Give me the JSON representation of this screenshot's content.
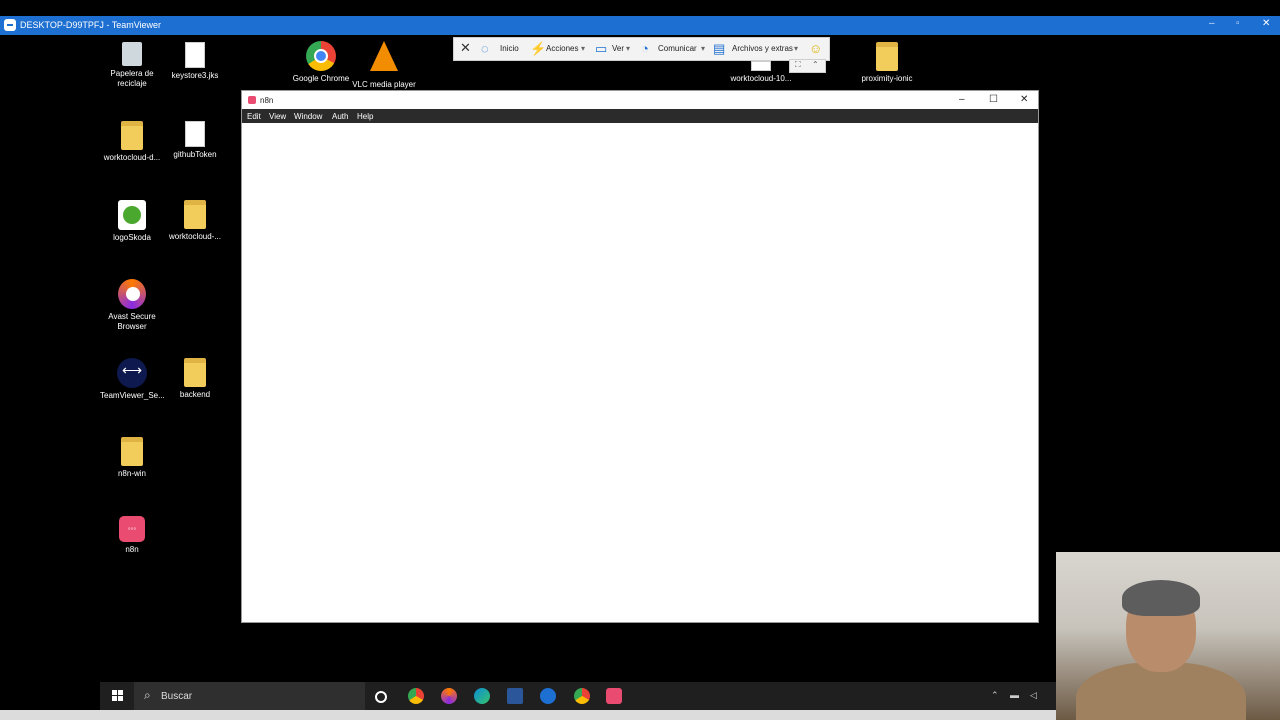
{
  "teamviewer": {
    "title": "DESKTOP-D99TPFJ - TeamViewer",
    "toolbar": {
      "close": "✕",
      "inicio": "Inicio",
      "acciones": "Acciones",
      "ver": "Ver",
      "comunicar": "Comunicar",
      "archivos": "Archivos y extras"
    }
  },
  "desktop_icons": {
    "recycle": "Papelera de reciclaje",
    "keystore": "keystore3.jks",
    "chrome": "Google Chrome",
    "vlc": "VLC media player",
    "worktocloud10": "worktocloud-10...",
    "proximity": "proximity-ionic",
    "worktocloud_d": "worktocloud-d...",
    "githubtoken": "githubToken",
    "logoskoda": "logoSkoda",
    "worktocloud_2": "worktocloud-...",
    "avast": "Avast Secure Browser",
    "teamviewer_se": "TeamViewer_Se...",
    "backend": "backend",
    "n8nwin": "n8n-win",
    "n8n": "n8n"
  },
  "n8n_window": {
    "title": "n8n",
    "menu": [
      "Edit",
      "View",
      "Window",
      "Auth",
      "Help"
    ]
  },
  "taskbar": {
    "search_placeholder": "Buscar"
  }
}
